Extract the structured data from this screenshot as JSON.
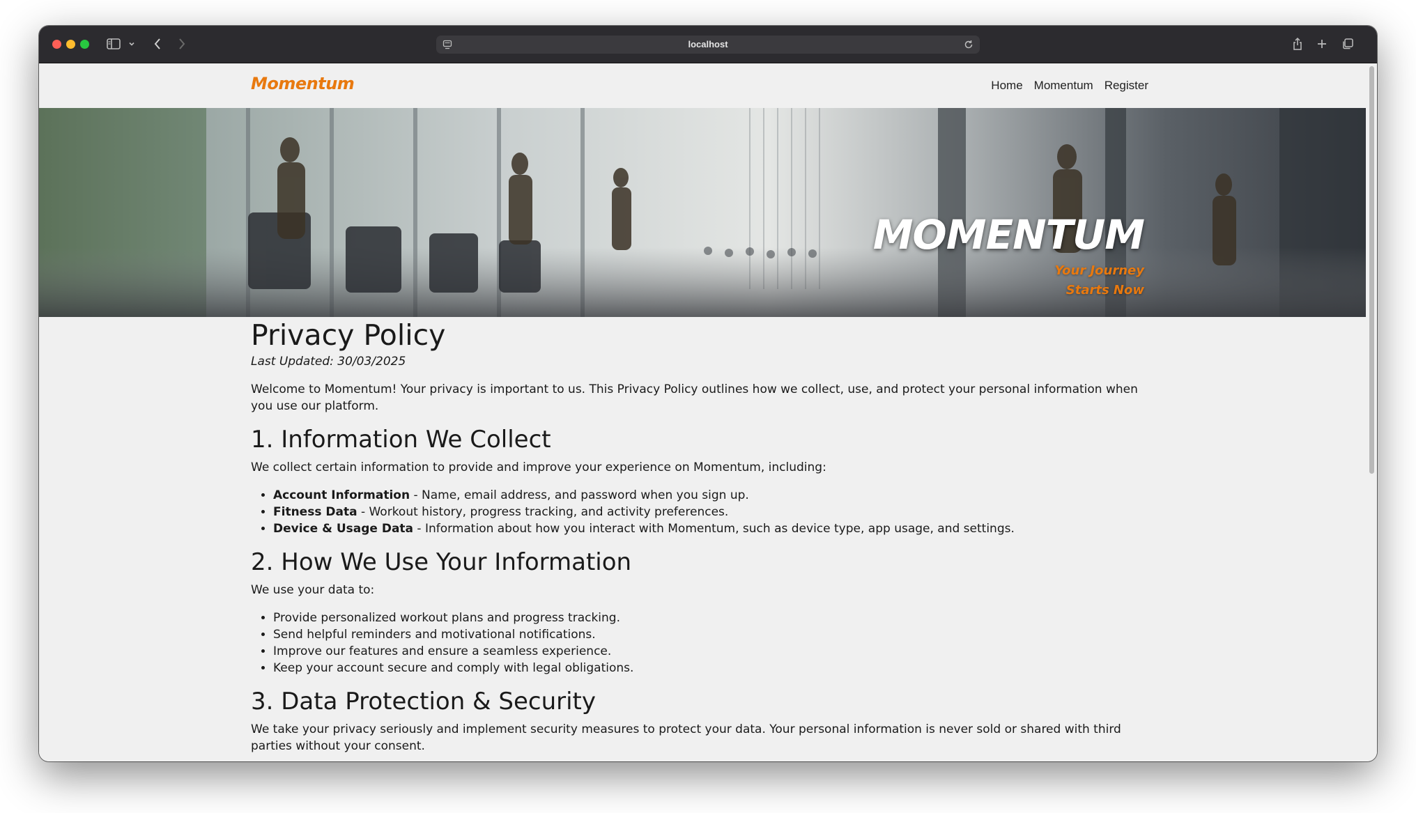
{
  "browser": {
    "url": "localhost",
    "icons": [
      "sidebar-icon",
      "chevron-down-icon",
      "back-icon",
      "forward-icon",
      "page-settings-icon",
      "reload-icon",
      "share-icon",
      "new-tab-icon",
      "tabs-overview-icon"
    ]
  },
  "nav": {
    "brand": "Momentum",
    "links": [
      "Home",
      "Momentum",
      "Register"
    ]
  },
  "hero": {
    "title": "MOMENTUM",
    "subtitle_line1": "Your Journey",
    "subtitle_line2": "Starts Now"
  },
  "policy": {
    "title": "Privacy Policy",
    "last_updated": "Last Updated: 30/03/2025",
    "intro": "Welcome to Momentum! Your privacy is important to us. This Privacy Policy outlines how we collect, use, and protect your personal information when you use our platform.",
    "sections": [
      {
        "heading": "1. Information We Collect",
        "text": "We collect certain information to provide and improve your experience on Momentum, including:",
        "items": [
          {
            "label": "Account Information",
            "text": " - Name, email address, and password when you sign up."
          },
          {
            "label": "Fitness Data",
            "text": " - Workout history, progress tracking, and activity preferences."
          },
          {
            "label": "Device & Usage Data",
            "text": " - Information about how you interact with Momentum, such as device type, app usage, and settings."
          }
        ]
      },
      {
        "heading": "2. How We Use Your Information",
        "text": "We use your data to:",
        "items": [
          {
            "text": "Provide personalized workout plans and progress tracking."
          },
          {
            "text": "Send helpful reminders and motivational notifications."
          },
          {
            "text": "Improve our features and ensure a seamless experience."
          },
          {
            "text": "Keep your account secure and comply with legal obligations."
          }
        ]
      },
      {
        "heading": "3. Data Protection & Security",
        "text": "We take your privacy seriously and implement security measures to protect your data. Your personal information is never sold or shared with third parties without your consent."
      }
    ]
  }
}
